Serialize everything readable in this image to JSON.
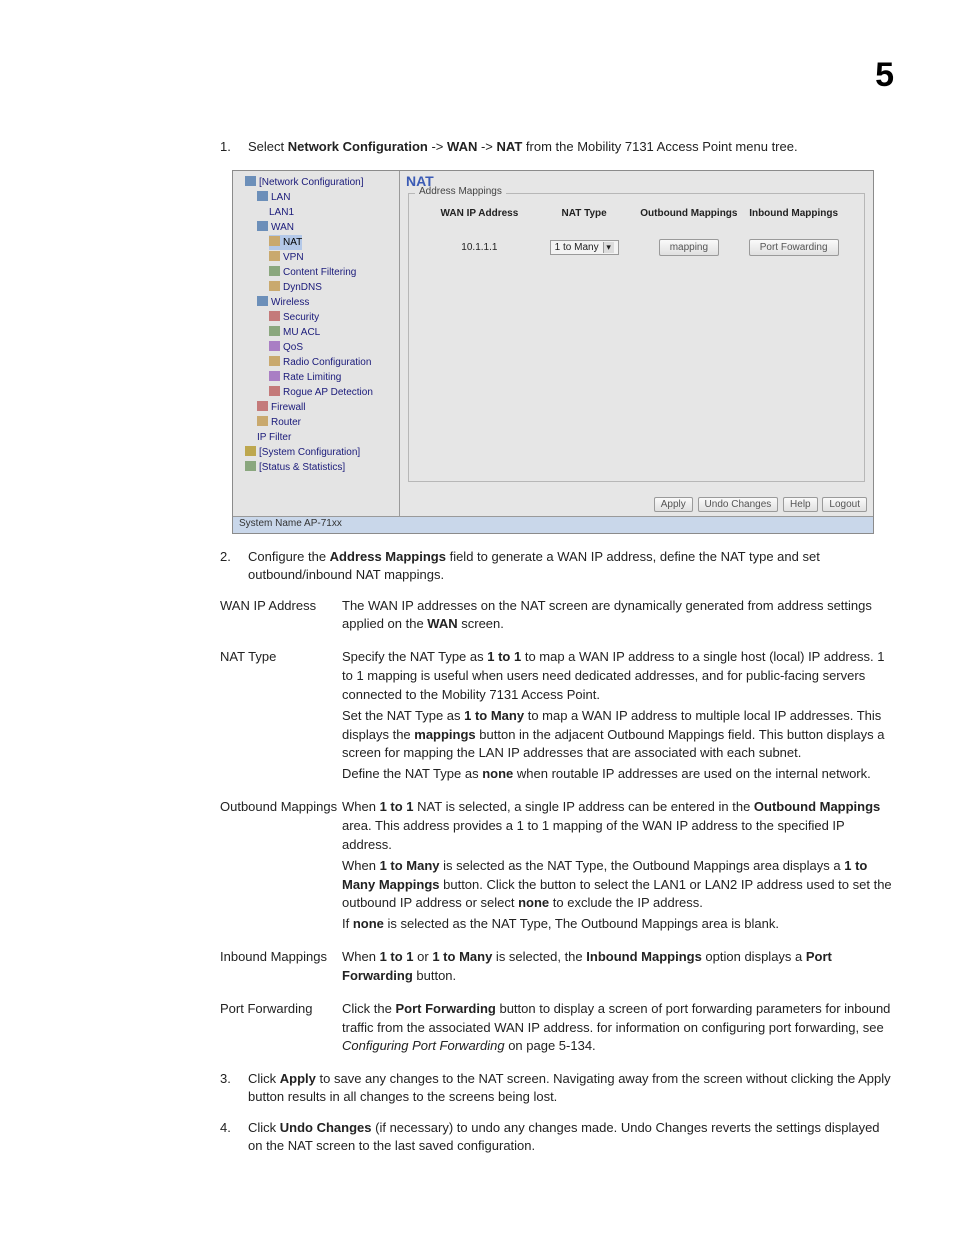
{
  "chapter_number": "5",
  "steps": {
    "s1": {
      "num": "1.",
      "pre": "Select ",
      "b1": "Network Configuration",
      "sep1": " -> ",
      "b2": "WAN",
      "sep2": " -> ",
      "b3": "NAT",
      "post": " from the Mobility 7131 Access Point menu tree."
    },
    "s2": {
      "num": "2.",
      "pre": "Configure the ",
      "b1": "Address Mappings",
      "post": " field to generate a WAN IP address, define the NAT type and set outbound/inbound NAT mappings."
    },
    "s3": {
      "num": "3.",
      "pre": "Click ",
      "b1": "Apply",
      "post": " to save any changes to the NAT screen. Navigating away from the screen without clicking the Apply button results in all changes to the screens being lost."
    },
    "s4": {
      "num": "4.",
      "pre": "Click ",
      "b1": "Undo Changes",
      "post": " (if necessary) to undo any changes made. Undo Changes reverts the settings displayed on the NAT screen to the last saved configuration."
    }
  },
  "screenshot": {
    "tab_title": "NAT",
    "fieldset_label": "Address Mappings",
    "columns": {
      "c1": "WAN IP Address",
      "c2": "NAT Type",
      "c3": "Outbound Mappings",
      "c4": "Inbound Mappings"
    },
    "row": {
      "ip": "10.1.1.1",
      "type": "1 to Many",
      "outbound_btn": "mapping",
      "inbound_btn": "Port Fowarding"
    },
    "buttons": {
      "apply": "Apply",
      "undo": "Undo Changes",
      "help": "Help",
      "logout": "Logout"
    },
    "status": "System Name AP-71xx",
    "tree": {
      "n0": "[Network Configuration]",
      "n1": "LAN",
      "n2": "LAN1",
      "n3": "WAN",
      "n4": "NAT",
      "n5": "VPN",
      "n6": "Content Filtering",
      "n7": "DynDNS",
      "n8": "Wireless",
      "n9": "Security",
      "n10": "MU ACL",
      "n11": "QoS",
      "n12": "Radio Configuration",
      "n13": "Rate Limiting",
      "n14": "Rogue AP Detection",
      "n15": "Firewall",
      "n16": "Router",
      "n17": "IP Filter",
      "n18": "[System Configuration]",
      "n19": "[Status & Statistics]"
    }
  },
  "defs": {
    "wan_ip": {
      "term": "WAN IP Address",
      "p1a": "The WAN IP addresses on the NAT screen are dynamically generated from address settings applied on the ",
      "p1b": "WAN",
      "p1c": " screen."
    },
    "nat_type": {
      "term": "NAT Type",
      "p1a": "Specify the NAT Type as ",
      "p1b": "1 to 1",
      "p1c": " to map a WAN IP address to a single host (local) IP address. 1 to 1 mapping is useful when users need dedicated addresses, and for public-facing servers connected to the Mobility 7131 Access Point.",
      "p2a": "Set the NAT Type as ",
      "p2b": "1 to Many",
      "p2c": " to map a WAN IP address to multiple local IP addresses. This displays the ",
      "p2d": "mappings",
      "p2e": " button in the adjacent Outbound Mappings field. This button displays a screen for mapping the LAN IP addresses that are associated with each subnet.",
      "p3a": "Define the NAT Type as ",
      "p3b": "none",
      "p3c": " when routable IP addresses are used on the internal network."
    },
    "outbound": {
      "term": "Outbound Mappings",
      "p1a": "When ",
      "p1b": "1 to 1",
      "p1c": " NAT is selected, a single IP address can be entered in the ",
      "p1d": "Outbound Mappings",
      "p1e": " area. This address provides a 1 to 1 mapping of the WAN IP address to the specified IP address.",
      "p2a": "When ",
      "p2b": "1 to Many",
      "p2c": " is selected as the NAT Type, the Outbound Mappings area displays a ",
      "p2d": "1 to Many Mappings",
      "p2e": " button. Click the button to select the LAN1 or LAN2 IP address used to set the outbound IP address or select ",
      "p2f": "none",
      "p2g": " to exclude the IP address.",
      "p3a": "If ",
      "p3b": "none",
      "p3c": " is selected as the NAT Type, The Outbound Mappings area is blank."
    },
    "inbound": {
      "term": "Inbound Mappings",
      "p1a": "When ",
      "p1b": "1 to 1",
      "p1c": " or ",
      "p1d": "1 to Many",
      "p1e": " is selected, the ",
      "p1f": "Inbound Mappings",
      "p1g": " option displays a ",
      "p1h": "Port Forwarding",
      "p1i": " button."
    },
    "portfwd": {
      "term": "Port Forwarding",
      "p1a": "Click the ",
      "p1b": "Port Forwarding",
      "p1c": " button to display a screen of port forwarding parameters for inbound traffic from the associated WAN IP address. for information on configuring port forwarding, see ",
      "p1d": "Configuring Port Forwarding",
      "p1e": " on page 5-134."
    }
  }
}
